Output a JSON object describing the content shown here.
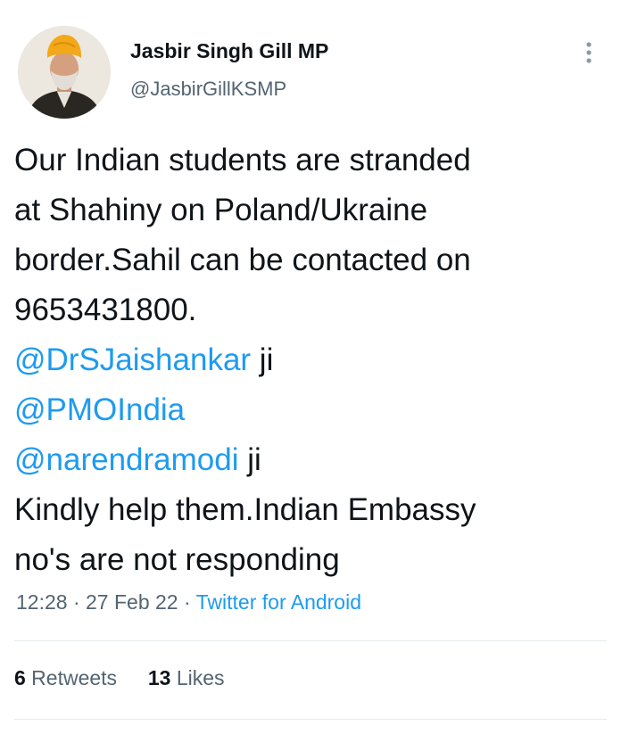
{
  "user": {
    "display_name": "Jasbir Singh Gill MP",
    "handle": "@JasbirGillKSMP",
    "avatar_icon": "profile-photo-turban"
  },
  "tweet": {
    "line1": "Our Indian students are stranded",
    "line2": "at Shahiny on Poland/Ukraine",
    "line3": "border.Sahil can be contacted on",
    "line4": "9653431800.",
    "mention1": "@DrSJaishankar",
    "mention1_suffix": " ji",
    "mention2": "@PMOIndia",
    "mention3": "@narendramodi",
    "mention3_suffix": " ji",
    "line8": "Kindly help them.Indian Embassy",
    "line9": "no's are not responding"
  },
  "meta": {
    "time": "12:28",
    "sep1": " · ",
    "date": "27 Feb 22",
    "sep2": " · ",
    "source": "Twitter for Android"
  },
  "stats": {
    "retweets_count": "6",
    "retweets_label": " Retweets",
    "likes_count": "13",
    "likes_label": " Likes"
  },
  "colors": {
    "accent": "#1d9bf0",
    "secondary_text": "#536471",
    "primary_text": "#0f1419",
    "turban": "#f2a818"
  }
}
